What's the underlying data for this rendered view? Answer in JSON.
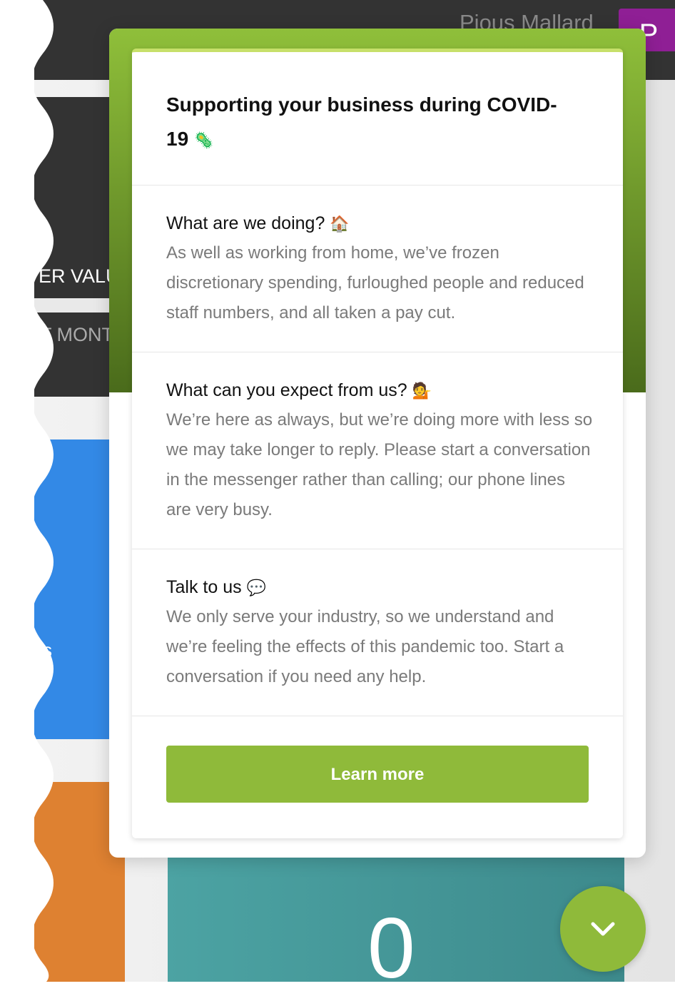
{
  "header": {
    "user_name": "Pious Mallard",
    "avatar_initial": "P"
  },
  "background": {
    "card1_label": "ER VALU",
    "card2_label": "T MONTH",
    "blue_card_label": "s",
    "teal_value": "0"
  },
  "notice": {
    "title": "Supporting your business during COVID-19",
    "title_emoji": "🦠",
    "sections": [
      {
        "question": "What are we doing?",
        "emoji": "🏠",
        "body": "As well as working from home, we’ve frozen discretionary spending, furloughed people and reduced staff numbers, and all taken a pay cut."
      },
      {
        "question": "What can you expect from us?",
        "emoji": "💁",
        "body": "We’re here as always, but we’re doing more with less so we may take longer to reply. Please start a conversation in the messenger rather than calling; our phone lines are very busy."
      },
      {
        "question": "Talk to us",
        "emoji": "💬",
        "body": "We only serve your industry, so we understand and we’re feeling the effects of this pandemic too. Start a conversation if you need any help."
      }
    ],
    "button_label": "Learn more"
  },
  "launcher": {
    "icon": "chevron-down-icon"
  },
  "colors": {
    "accent_green": "#8fba3a",
    "header_green_dark": "#4a6b1b",
    "avatar_purple": "#8f1f95",
    "blue_card": "#3389e6",
    "orange_card": "#de8131",
    "teal_card": "#3d8a8c"
  }
}
